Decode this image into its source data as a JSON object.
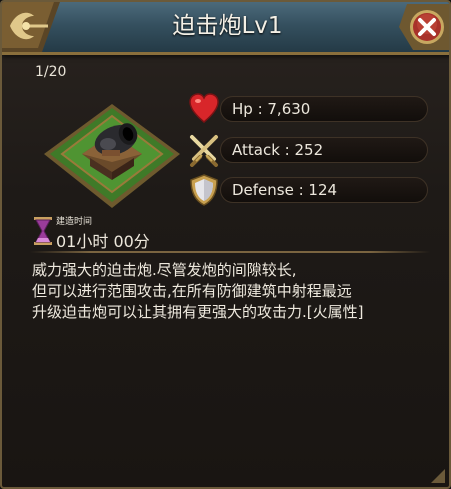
{
  "window": {
    "title": "迫击炮Lv1"
  },
  "building": {
    "counter": "1/20",
    "image": "mortar-cannon-on-grass-tile"
  },
  "stats": [
    {
      "icon": "heart-icon",
      "text": "Hp : 7,630"
    },
    {
      "icon": "crossed-swords-icon",
      "text": "Attack : 252"
    },
    {
      "icon": "shield-icon",
      "text": "Defense : 124"
    }
  ],
  "build_time": {
    "label": "建造时间",
    "value": "01小时 00分"
  },
  "description": [
    "威力强大的迫击炮.尽管发炮的间隙较长,",
    "但可以进行范围攻击,在所有防御建筑中射程最远",
    "升级迫击炮可以让其拥有更强大的攻击力.[火属性]"
  ],
  "colors": {
    "title_bar": "#35505f",
    "panel_bg": "#1e1a17",
    "frame_gold": "#8a6f3c",
    "close_red": "#a8322a",
    "heart_red": "#d8262a"
  }
}
